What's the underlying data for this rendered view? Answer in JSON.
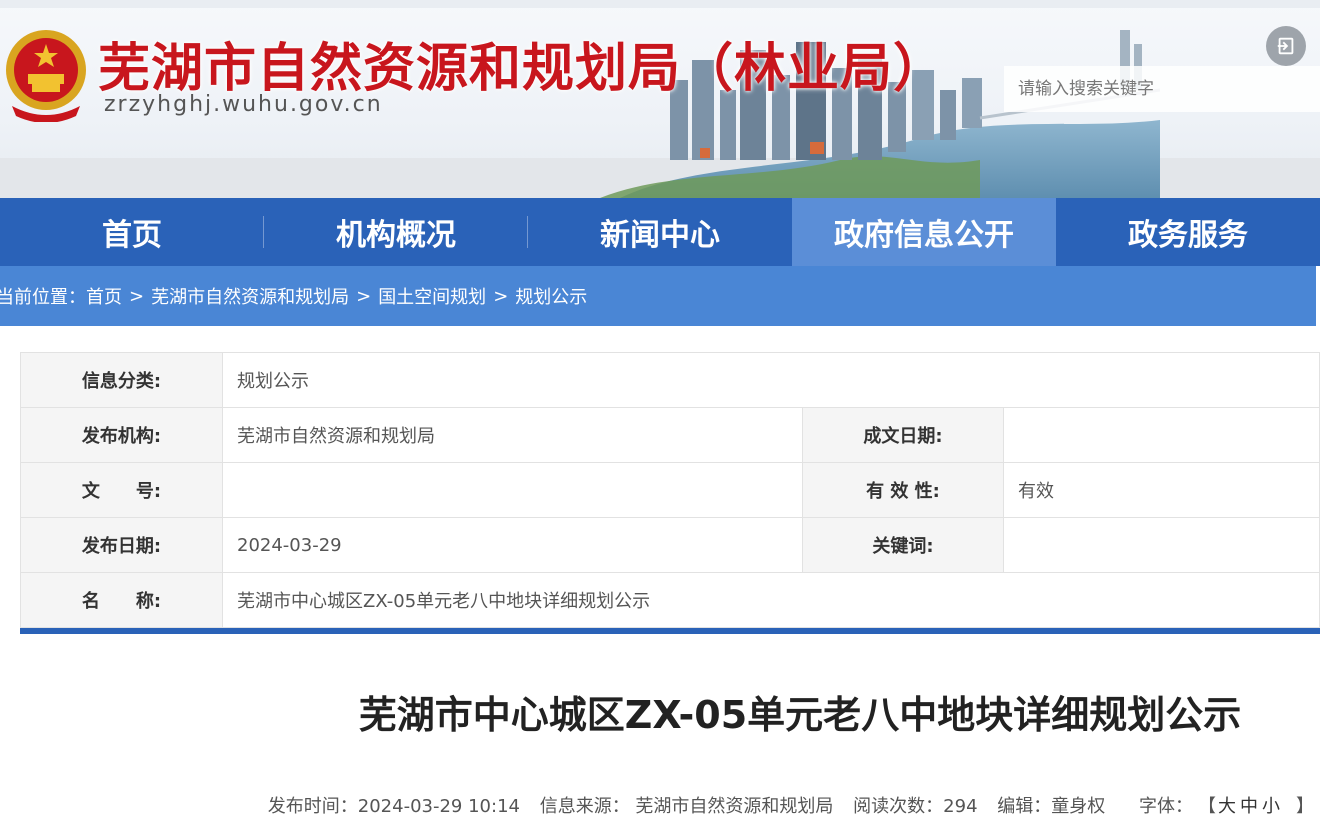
{
  "header": {
    "site_title": "芜湖市自然资源和规划局（林业局）",
    "site_url": "zrzyhghj.wuhu.gov.cn",
    "search_placeholder": "请输入搜索关键字"
  },
  "nav": {
    "items": [
      {
        "label": "首页"
      },
      {
        "label": "机构概况"
      },
      {
        "label": "新闻中心"
      },
      {
        "label": "政府信息公开",
        "active": true
      },
      {
        "label": "政务服务"
      }
    ]
  },
  "breadcrumb": {
    "prefix": "当前位置：",
    "items": [
      "首页",
      "芜湖市自然资源和规划局",
      "国土空间规划",
      "规划公示"
    ],
    "separator": ">"
  },
  "info": {
    "category_label": "信息分类:",
    "category_value": "规划公示",
    "publisher_label": "发布机构:",
    "publisher_value": "芜湖市自然资源和规划局",
    "created_label": "成文日期:",
    "created_value": "",
    "doc_no_label": "文　　号:",
    "doc_no_value": "",
    "validity_label": "有 效 性:",
    "validity_value": "有效",
    "pub_date_label": "发布日期:",
    "pub_date_value": "2024-03-29",
    "keywords_label": "关键词:",
    "keywords_value": "",
    "name_label": "名　　称:",
    "name_value": "芜湖市中心城区ZX-05单元老八中地块详细规划公示"
  },
  "article": {
    "title": "芜湖市中心城区ZX-05单元老八中地块详细规划公示",
    "meta": {
      "time": "发布时间：2024-03-29 10:14",
      "source": "信息来源：  芜湖市自然资源和规划局",
      "views": "阅读次数：294",
      "editor": "编辑：童身权",
      "font_label": "字体：",
      "font_open": "【",
      "font_large": "大",
      "font_medium": "中",
      "font_small": "小",
      "font_close": "】"
    }
  },
  "colors": {
    "nav_bg": "#2a62b8",
    "nav_active": "#5b8ed7",
    "breadcrumb_bg": "#4a86d5",
    "title_red": "#c8161d"
  }
}
